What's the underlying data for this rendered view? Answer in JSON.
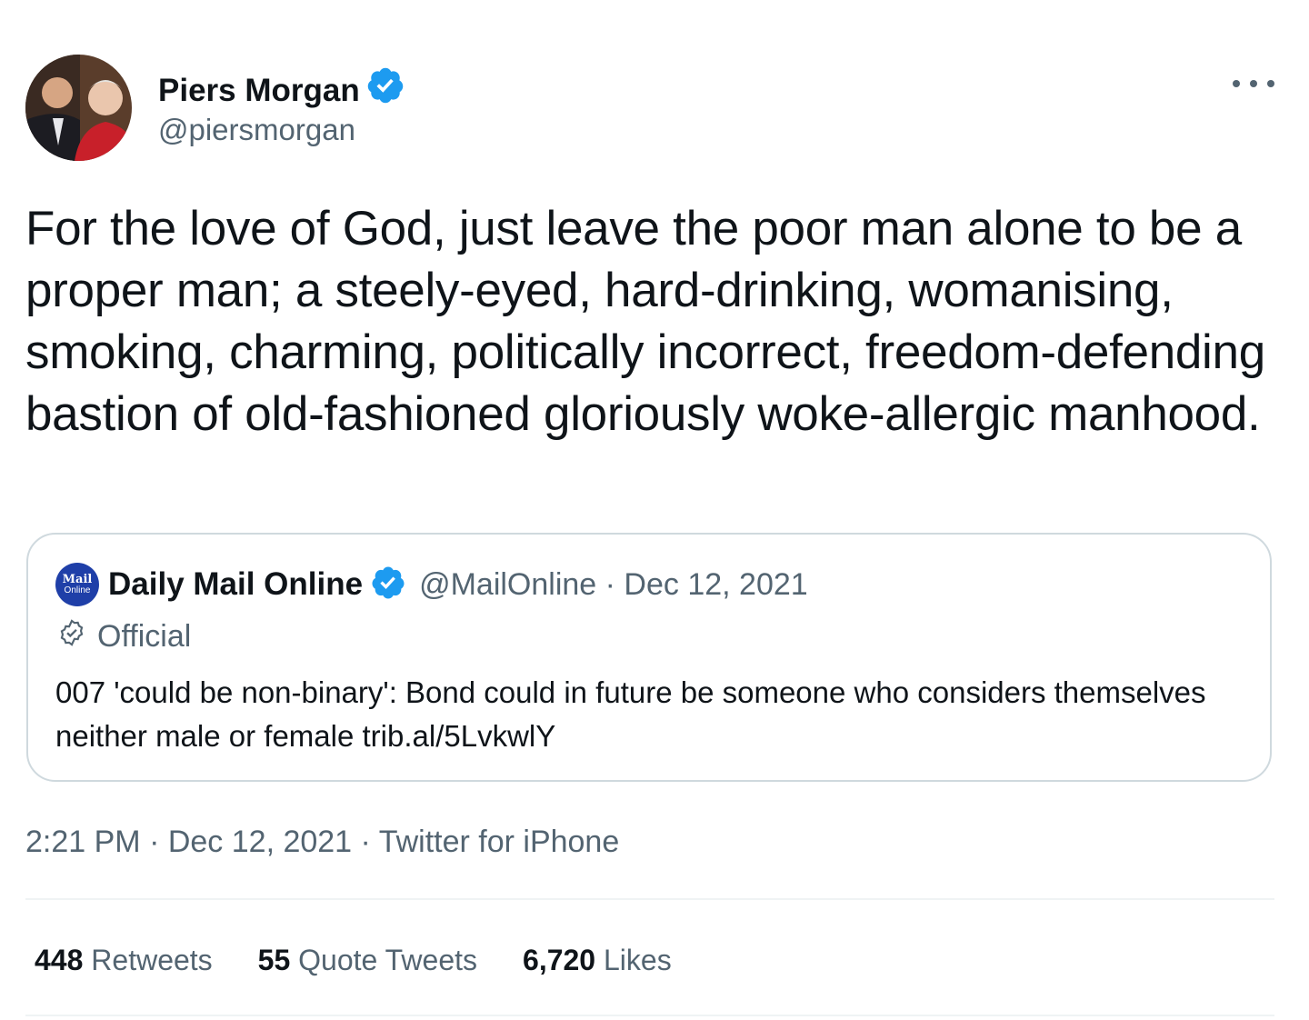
{
  "author": {
    "name": "Piers Morgan",
    "handle": "@piersmorgan",
    "verified": true
  },
  "tweet": {
    "text": "For the love of God, just leave the poor man alone to be a proper man; a steely-eyed, hard-drinking, womanising, smoking, charming, politically incorrect, freedom-defending bastion of old-fashioned gloriously woke-allergic manhood.",
    "timestamp": "2:21 PM · Dec 12, 2021 · Twitter for iPhone"
  },
  "quoted_tweet": {
    "logo_line1": "Mail",
    "logo_line2": "Online",
    "name": "Daily Mail Online",
    "meta": "@MailOnline · Dec 12, 2021",
    "official_label": "Official",
    "text": "007 'could be non-binary': Bond could in future be someone who considers themselves neither male or female trib.al/5LvkwlY"
  },
  "stats": [
    {
      "count": "448",
      "label": "Retweets"
    },
    {
      "count": "55",
      "label": "Quote Tweets"
    },
    {
      "count": "6,720",
      "label": "Likes"
    }
  ],
  "colors": {
    "verified": "#1d9bf0",
    "text_primary": "#0f1419",
    "text_secondary": "#536471",
    "border": "#cfd9de"
  },
  "icons": [
    "verified-badge-icon",
    "more-options-icon",
    "official-badge-icon"
  ]
}
